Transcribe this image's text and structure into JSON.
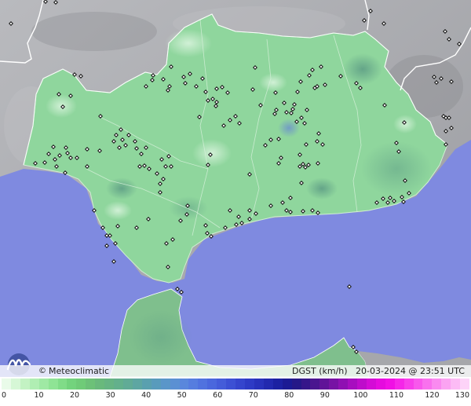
{
  "brand": {
    "copyright_symbol": "©",
    "name": "Meteoclimatic"
  },
  "product": {
    "variable": "DGST (km/h)",
    "date": "20-03-2024",
    "at": "@",
    "time": "23:51 UTC"
  },
  "colors": {
    "sea": "#7f8ae0",
    "land_outside": "#a6a7ab",
    "region_fill": "#8fd69d",
    "borders": "#ffffff",
    "station_marker": "#111111"
  },
  "icons": {
    "logo": "meteoclimatic-logo-icon",
    "station": "weather-station-marker-icon"
  },
  "scale": {
    "unit_label": "km/h",
    "ticks": [
      "0",
      "10",
      "20",
      "30",
      "40",
      "50",
      "60",
      "70",
      "80",
      "90",
      "100",
      "110",
      "120",
      "130"
    ],
    "colors": [
      "#e9fbe9",
      "#d6f7d6",
      "#c3f2c3",
      "#b0eeb3",
      "#9fe9a4",
      "#8fe495",
      "#80dc88",
      "#73d37d",
      "#6fcb78",
      "#6cc178",
      "#69b97c",
      "#66b483",
      "#63b08c",
      "#61ab96",
      "#5ea6a2",
      "#5aa0af",
      "#599bbc",
      "#5a96c9",
      "#5b90d3",
      "#5a87dc",
      "#567ddf",
      "#5072df",
      "#4a67dd",
      "#445cd9",
      "#3c50d4",
      "#3545cd",
      "#2e3bc5",
      "#2832bb",
      "#2229af",
      "#1c21a2",
      "#1b1a94",
      "#251888",
      "#35168a",
      "#4a158f",
      "#601398",
      "#7712a4",
      "#8f10b2",
      "#a70ebf",
      "#be0ccb",
      "#d40bd6",
      "#e50bde",
      "#f010e4",
      "#f526e8",
      "#f73fea",
      "#f858ec",
      "#f971ee",
      "#fa8af0",
      "#fba3f2",
      "#fcbbf5",
      "#fdd3f8"
    ]
  },
  "map": {
    "stations": [
      [
        14,
        30
      ],
      [
        58,
        2
      ],
      [
        71,
        3
      ],
      [
        95,
        95
      ],
      [
        103,
        97
      ],
      [
        80,
        136
      ],
      [
        75,
        120
      ],
      [
        90,
        122
      ],
      [
        68,
        187
      ],
      [
        70,
        203
      ],
      [
        76,
        198
      ],
      [
        84,
        188
      ],
      [
        86,
        195
      ],
      [
        90,
        201
      ],
      [
        98,
        201
      ],
      [
        72,
        212
      ],
      [
        57,
        207
      ],
      [
        45,
        208
      ],
      [
        62,
        196
      ],
      [
        83,
        220
      ],
      [
        111,
        212
      ],
      [
        111,
        190
      ],
      [
        127,
        192
      ],
      [
        128,
        148
      ],
      [
        148,
        172
      ],
      [
        154,
        165
      ],
      [
        145,
        180
      ],
      [
        152,
        188
      ],
      [
        160,
        185
      ],
      [
        156,
        178
      ],
      [
        164,
        172
      ],
      [
        172,
        180
      ],
      [
        174,
        189
      ],
      [
        180,
        196
      ],
      [
        186,
        188
      ],
      [
        184,
        211
      ],
      [
        178,
        212
      ],
      [
        190,
        215
      ],
      [
        200,
        221
      ],
      [
        206,
        203
      ],
      [
        215,
        199
      ],
      [
        211,
        212
      ],
      [
        218,
        212
      ],
      [
        208,
        228
      ],
      [
        204,
        234
      ],
      [
        204,
        245
      ],
      [
        189,
        279
      ],
      [
        174,
        290
      ],
      [
        150,
        288
      ],
      [
        140,
        300
      ],
      [
        147,
        310
      ],
      [
        136,
        313
      ],
      [
        136,
        300
      ],
      [
        120,
        268
      ],
      [
        145,
        333
      ],
      [
        131,
        290
      ],
      [
        195,
        96
      ],
      [
        194,
        102
      ],
      [
        186,
        110
      ],
      [
        214,
        115
      ],
      [
        216,
        110
      ],
      [
        208,
        101
      ],
      [
        218,
        85
      ],
      [
        234,
        98
      ],
      [
        236,
        106
      ],
      [
        242,
        94
      ],
      [
        250,
        110
      ],
      [
        265,
        128
      ],
      [
        271,
        126
      ],
      [
        276,
        130
      ],
      [
        276,
        113
      ],
      [
        283,
        111
      ],
      [
        290,
        118
      ],
      [
        275,
        135
      ],
      [
        258,
        100
      ],
      [
        262,
        117
      ],
      [
        254,
        149
      ],
      [
        268,
        197
      ],
      [
        265,
        210
      ],
      [
        239,
        262
      ],
      [
        238,
        273
      ],
      [
        230,
        281
      ],
      [
        220,
        305
      ],
      [
        212,
        310
      ],
      [
        214,
        340
      ],
      [
        226,
        368
      ],
      [
        231,
        372
      ],
      [
        262,
        287
      ],
      [
        264,
        297
      ],
      [
        269,
        301
      ],
      [
        293,
        268
      ],
      [
        287,
        290
      ],
      [
        301,
        286
      ],
      [
        304,
        276
      ],
      [
        308,
        284
      ],
      [
        318,
        279
      ],
      [
        318,
        268
      ],
      [
        326,
        272
      ],
      [
        345,
        262
      ],
      [
        360,
        258
      ],
      [
        365,
        268
      ],
      [
        370,
        252
      ],
      [
        370,
        270
      ],
      [
        386,
        269
      ],
      [
        398,
        268
      ],
      [
        405,
        271
      ],
      [
        384,
        233
      ],
      [
        382,
        212
      ],
      [
        386,
        209
      ],
      [
        389,
        213
      ],
      [
        393,
        210
      ],
      [
        382,
        197
      ],
      [
        390,
        184
      ],
      [
        388,
        157
      ],
      [
        378,
        155
      ],
      [
        371,
        144
      ],
      [
        375,
        133
      ],
      [
        373,
        139
      ],
      [
        384,
        150
      ],
      [
        391,
        140
      ],
      [
        404,
        180
      ],
      [
        406,
        170
      ],
      [
        411,
        184
      ],
      [
        352,
        140
      ],
      [
        362,
        131
      ],
      [
        365,
        143
      ],
      [
        355,
        177
      ],
      [
        358,
        201
      ],
      [
        355,
        208
      ],
      [
        379,
        117
      ],
      [
        383,
        104
      ],
      [
        394,
        96
      ],
      [
        401,
        112
      ],
      [
        404,
        110
      ],
      [
        398,
        89
      ],
      [
        409,
        85
      ],
      [
        414,
        108
      ],
      [
        434,
        97
      ],
      [
        454,
        106
      ],
      [
        459,
        112
      ],
      [
        293,
        153
      ],
      [
        300,
        148
      ],
      [
        305,
        157
      ],
      [
        285,
        160
      ],
      [
        325,
        86
      ],
      [
        322,
        114
      ],
      [
        332,
        134
      ],
      [
        351,
        118
      ],
      [
        338,
        185
      ],
      [
        345,
        178
      ],
      [
        318,
        222
      ],
      [
        405,
        208
      ],
      [
        350,
        145
      ],
      [
        490,
        134
      ],
      [
        515,
        156
      ],
      [
        505,
        182
      ],
      [
        508,
        193
      ],
      [
        516,
        230
      ],
      [
        480,
        258
      ],
      [
        488,
        253
      ],
      [
        494,
        258
      ],
      [
        497,
        252
      ],
      [
        502,
        256
      ],
      [
        512,
        251
      ],
      [
        514,
        257
      ],
      [
        521,
        246
      ],
      [
        567,
        40
      ],
      [
        572,
        50
      ],
      [
        585,
        56
      ],
      [
        553,
        98
      ],
      [
        556,
        105
      ],
      [
        562,
        100
      ],
      [
        575,
        104
      ],
      [
        565,
        148
      ],
      [
        568,
        150
      ],
      [
        572,
        150
      ],
      [
        575,
        163
      ],
      [
        568,
        167
      ],
      [
        568,
        184
      ],
      [
        445,
        365
      ],
      [
        450,
        442
      ],
      [
        454,
        448
      ],
      [
        464,
        26
      ],
      [
        472,
        14
      ],
      [
        489,
        30
      ]
    ]
  }
}
